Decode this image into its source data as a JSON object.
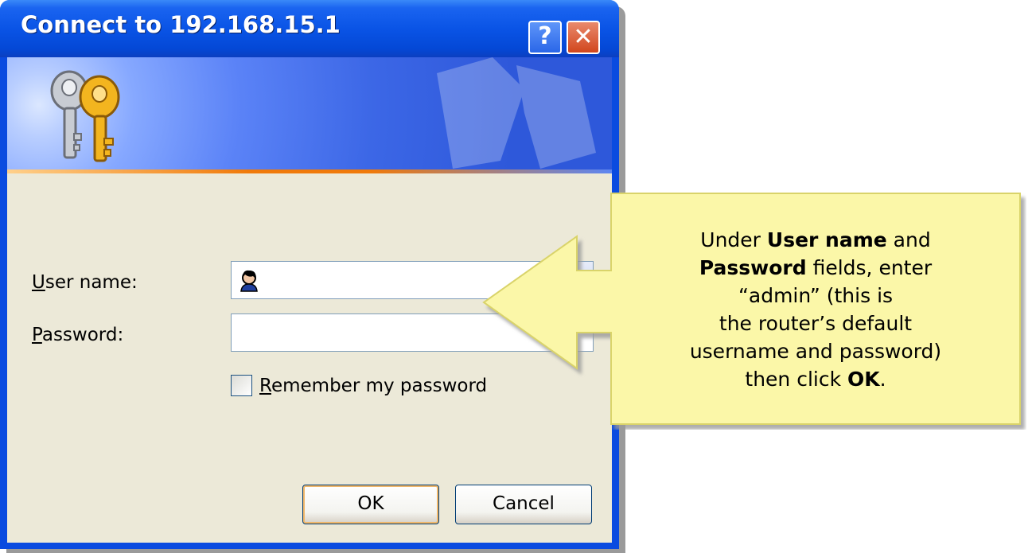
{
  "window": {
    "title": "Connect to 192.168.15.1",
    "help_glyph": "?",
    "close_glyph": "✕"
  },
  "form": {
    "username_label": {
      "access_key": "U",
      "rest": "ser name:"
    },
    "password_label": {
      "access_key": "P",
      "rest": "assword:"
    },
    "username_value": "",
    "password_value": "",
    "remember_label": {
      "access_key": "R",
      "rest": "emember my password"
    },
    "remember_checked": false
  },
  "buttons": {
    "ok": "OK",
    "cancel": "Cancel"
  },
  "callout": {
    "p1": "Under ",
    "b1": "User name",
    "p2": " and",
    "b2": "Password",
    "p3": " fields, enter",
    "p4": "“admin” (this is",
    "p5": "the router’s default",
    "p6": "username and password)",
    "p7": "then click ",
    "b3": "OK",
    "p8": "."
  },
  "icons": {
    "banner": "keys-icon",
    "username_field": "user-account-icon",
    "autocomplete": "dropdown-arrow-icon"
  },
  "colors": {
    "titlebar": "#0a54e6",
    "dialog_face": "#ece9d8",
    "callout_fill": "#fbf7a8"
  }
}
